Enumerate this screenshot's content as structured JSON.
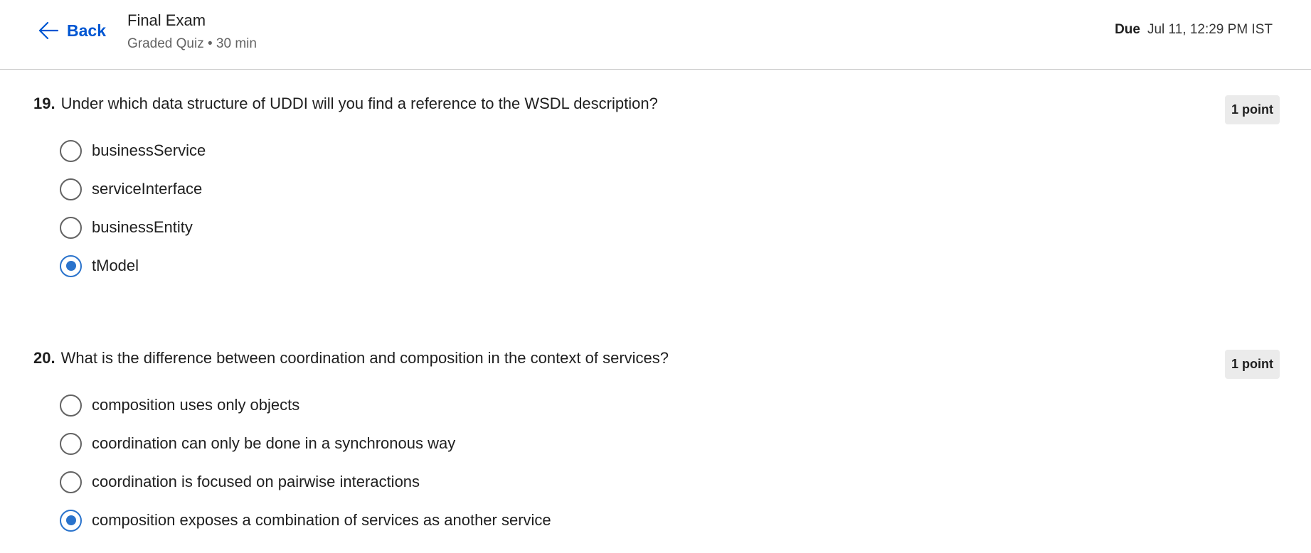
{
  "header": {
    "back_label": "Back",
    "title": "Final Exam",
    "subtitle": "Graded Quiz • 30 min",
    "due_label": "Due",
    "due_value": "Jul 11, 12:29 PM IST"
  },
  "questions": [
    {
      "number": "19.",
      "text": "Under which data structure of UDDI will you find a reference to the WSDL description?",
      "points": "1 point",
      "options": [
        {
          "label": "businessService",
          "selected": false
        },
        {
          "label": "serviceInterface",
          "selected": false
        },
        {
          "label": "businessEntity",
          "selected": false
        },
        {
          "label": "tModel",
          "selected": true
        }
      ]
    },
    {
      "number": "20.",
      "text": "What is the difference between coordination and composition in the context of services?",
      "points": "1 point",
      "options": [
        {
          "label": "composition uses only objects",
          "selected": false
        },
        {
          "label": "coordination can only be done in a synchronous way",
          "selected": false
        },
        {
          "label": "coordination is focused on pairwise interactions",
          "selected": false
        },
        {
          "label": "composition exposes a combination of services as another service",
          "selected": true
        }
      ]
    }
  ],
  "colors": {
    "link": "#0056d2",
    "radio_selected": "#2a73cc",
    "points_badge_bg": "#ebebeb"
  }
}
